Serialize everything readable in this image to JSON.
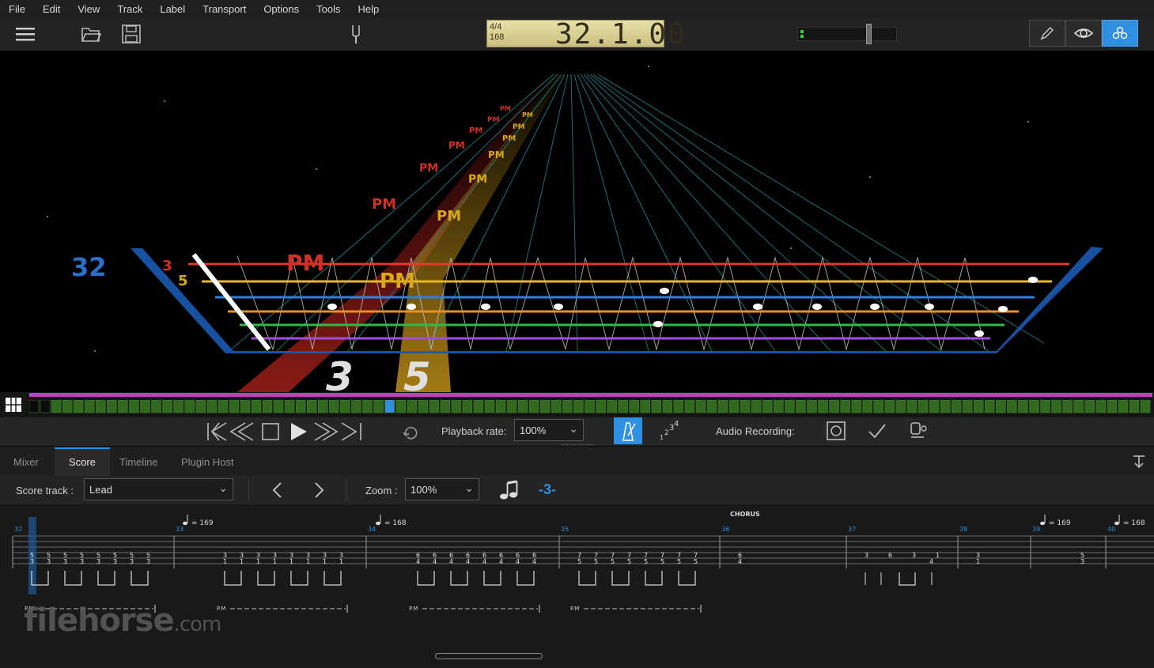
{
  "menu": [
    "File",
    "Edit",
    "View",
    "Track",
    "Label",
    "Transport",
    "Options",
    "Tools",
    "Help"
  ],
  "toolbar": {
    "time_signature": "4/4",
    "tempo": "168",
    "position": "32.1.00",
    "icons": [
      "hamburger-menu-icon",
      "open-folder-icon",
      "save-icon",
      "tuning-fork-icon",
      "pencil-icon",
      "eye-icon",
      "instrument-view-icon"
    ]
  },
  "fretboard": {
    "bar_number": "32",
    "lane_labels": [
      "PM",
      "PM"
    ],
    "fret_numbers": [
      "3",
      "5"
    ],
    "string_labels": [
      "3",
      "5"
    ],
    "string_colors": [
      "#e03a2a",
      "#e8b820",
      "#2f7fe0",
      "#e89020",
      "#2fb84a",
      "#a050d8"
    ]
  },
  "transport": {
    "playback_rate_label": "Playback rate:",
    "playback_rate_value": "100%",
    "audio_recording_label": "Audio Recording:"
  },
  "tabs": {
    "items": [
      "Mixer",
      "Score",
      "Timeline",
      "Plugin Host"
    ],
    "active": "Score"
  },
  "scorebar": {
    "score_track_label": "Score track :",
    "score_track_value": "Lead",
    "zoom_label": "Zoom :",
    "zoom_value": "100%",
    "triplet_label": "-3-"
  },
  "score": {
    "section_label": "CHORUS",
    "measure_numbers": [
      "32",
      "33",
      "34",
      "35",
      "36",
      "37",
      "38",
      "39",
      "40"
    ],
    "tempo_marks": [
      "= 169",
      "= 168",
      "= 169",
      "= 168"
    ],
    "palm_mute_label": "P.M",
    "measures": [
      {
        "top": "5 5 5 5 5 5 5 5",
        "bottom": "3 3 3 3 3 3 3 3"
      },
      {
        "top": "3 3 3 3 3 3 3 3",
        "bottom": "1 1 1 1 1 1 1 1"
      },
      {
        "top": "6 6 6 6 6 6 6 6",
        "bottom": "4 4 4 4 4 4 4 4"
      },
      {
        "top": "7 7 7 7 7 7 7 7",
        "bottom": "5 5 5 5 5 5 5 5"
      },
      {
        "top": "6",
        "bottom": "4"
      },
      {
        "top": "3 6 3 1",
        "bottom": "4"
      },
      {
        "top": "3",
        "bottom": "1"
      },
      {
        "top": "5",
        "bottom": "3"
      }
    ]
  },
  "watermark": {
    "brand": "filehorse",
    "tld": ".com"
  }
}
